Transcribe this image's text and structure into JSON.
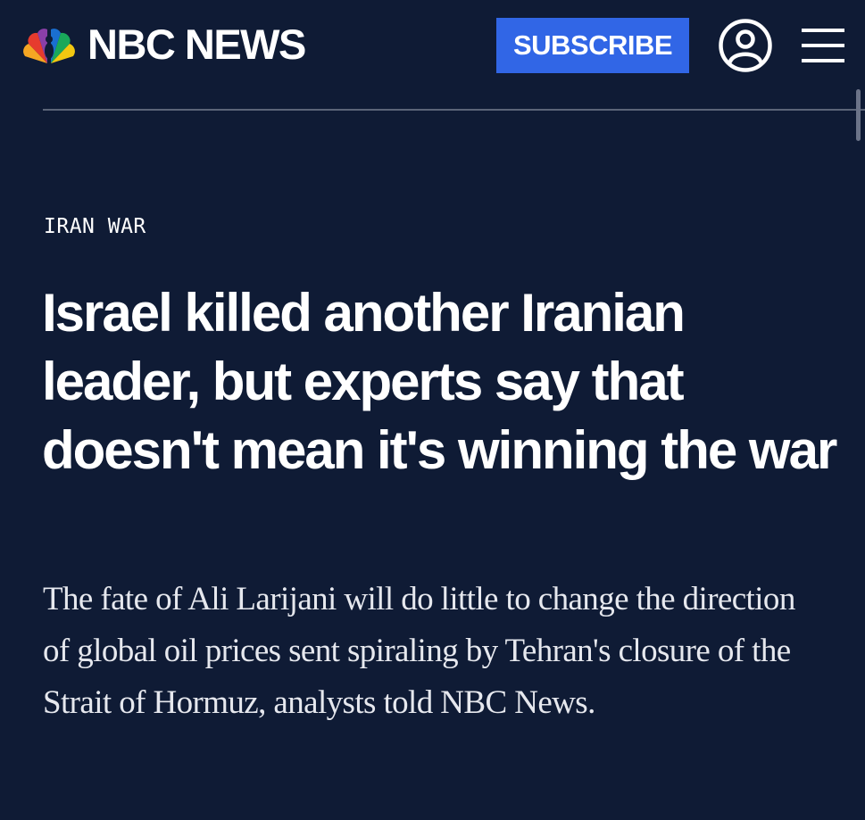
{
  "header": {
    "brand_name": "NBC NEWS",
    "logo_icon": "peacock-icon",
    "subscribe_label": "SUBSCRIBE",
    "account_icon": "user-circle-icon",
    "menu_icon": "hamburger-menu-icon"
  },
  "article": {
    "kicker": "IRAN WAR",
    "headline": "Israel killed another Iranian leader, but experts say that doesn't mean it's winning the war",
    "dek": "The fate of Ali Larijani will do little to change the direction of global oil prices sent spiraling by Tehran's closure of the Strait of Hormuz, analysts told NBC News."
  },
  "colors": {
    "background": "#0f1b35",
    "subscribe_button": "#3166e6",
    "text": "#ffffff",
    "divider": "#5b6478"
  }
}
